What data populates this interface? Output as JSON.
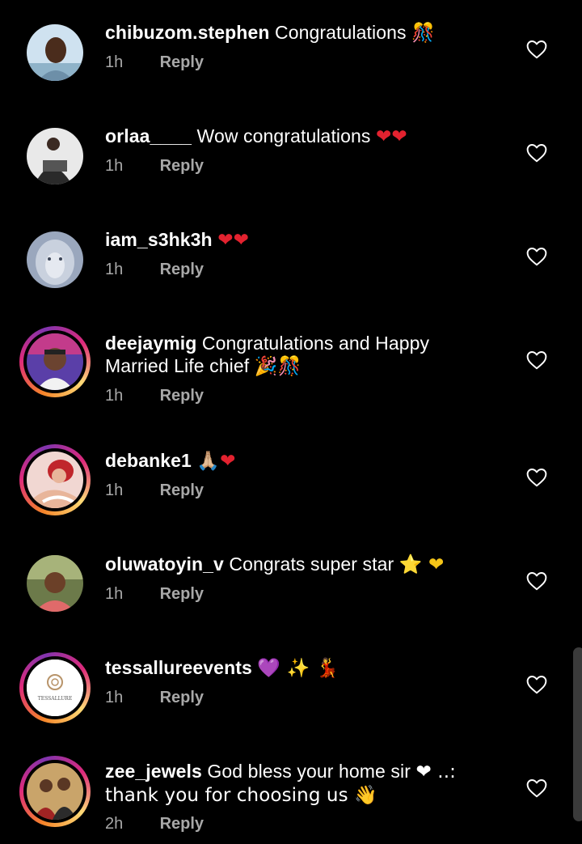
{
  "colors": {
    "background": "#000000",
    "text": "#ffffff",
    "muted": "#a8a8a8",
    "heart_red": "#e3222f",
    "star_yellow": "#f5c518",
    "purple_heart": "#7b3fbf"
  },
  "reply_label": "Reply",
  "comments": [
    {
      "username": "chibuzom.stephen",
      "text": "Congratulations",
      "emoji": "🎊",
      "emoji_icon": "confetti-ball-icon",
      "time": "1h",
      "story_ring": false
    },
    {
      "username": "orlaa____",
      "text": "Wow congratulations",
      "emoji": "❤❤",
      "emoji_icon": "red-heart-icon",
      "time": "1h",
      "story_ring": false
    },
    {
      "username": "iam_s3hk3h",
      "text": "",
      "emoji": "❤❤",
      "emoji_icon": "red-heart-icon",
      "time": "1h",
      "story_ring": false
    },
    {
      "username": "deejaymig",
      "text": "Congratulations and Happy Married Life chief",
      "emoji": "🎉🎊",
      "emoji_icon": "party-popper-icon",
      "time": "1h",
      "story_ring": true
    },
    {
      "username": "debanke1",
      "text": "",
      "emoji": "🙏🏼❤",
      "emoji_icon": "folded-hands-icon",
      "time": "1h",
      "story_ring": true
    },
    {
      "username": "oluwatoyin_v",
      "text": "Congrats super star",
      "emoji": "⭐ ❤",
      "emoji_icon": "star-icon",
      "time": "1h",
      "story_ring": false
    },
    {
      "username": "tessallureevents",
      "text": "",
      "emoji": "💜 ✨ 💃",
      "emoji_icon": "purple-heart-icon",
      "time": "1h",
      "story_ring": true,
      "avatar_text": "TESSALLURE"
    },
    {
      "username": "zee_jewels",
      "text": "God bless your home sir",
      "emoji": "❤ ..: thank you for choosing us 👋",
      "emoji_icon": "red-heart-icon",
      "time": "2h",
      "story_ring": true
    }
  ]
}
